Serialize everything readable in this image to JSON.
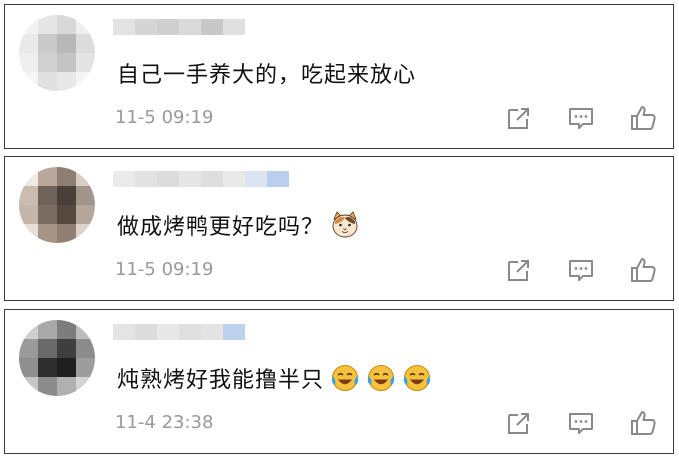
{
  "comments": [
    {
      "text": "自己一手养大的，吃起来放心",
      "time": "11-5 09:19",
      "emojis": []
    },
    {
      "text": "做成烤鸭更好吃吗？",
      "time": "11-5 09:19",
      "emojis": [
        "cat-face-emoji"
      ]
    },
    {
      "text": "炖熟烤好我能撸半只",
      "time": "11-4 23:38",
      "emojis": [
        "laughing-crying-emoji",
        "laughing-crying-emoji",
        "laughing-crying-emoji"
      ]
    }
  ],
  "icons": {
    "share": "share-icon",
    "comment": "comment-icon",
    "like": "thumbs-up-icon"
  },
  "colors": {
    "text": "#111111",
    "time": "#9a9a9a",
    "icon": "#8a8a8a",
    "border": "#3b3b3b"
  }
}
